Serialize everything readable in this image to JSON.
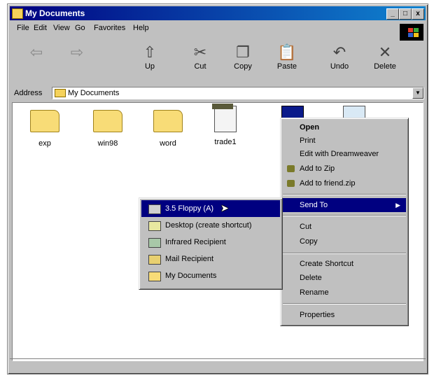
{
  "window": {
    "title": "My Documents",
    "controls": [
      "_",
      "□",
      "x"
    ]
  },
  "menubar": [
    "File",
    "Edit",
    "View",
    "Go",
    "Favorites",
    "Help"
  ],
  "toolbar": [
    {
      "label": "",
      "icon": "back-arrow-icon",
      "glyph": "⇦"
    },
    {
      "label": "",
      "icon": "forward-arrow-icon",
      "glyph": "⇨"
    },
    {
      "label": "Up",
      "icon": "up-folder-icon",
      "glyph": "⇧"
    },
    {
      "label": "Cut",
      "icon": "scissors-icon",
      "glyph": "✂"
    },
    {
      "label": "Copy",
      "icon": "copy-icon",
      "glyph": "❐"
    },
    {
      "label": "Paste",
      "icon": "paste-icon",
      "glyph": "📋"
    },
    {
      "label": "Undo",
      "icon": "undo-icon",
      "glyph": "↶"
    },
    {
      "label": "Delete",
      "icon": "delete-icon",
      "glyph": "✕"
    }
  ],
  "address": {
    "label": "Address",
    "value": "My Documents"
  },
  "files": [
    {
      "name": "exp",
      "type": "folder"
    },
    {
      "name": "win98",
      "type": "folder"
    },
    {
      "name": "word",
      "type": "folder"
    },
    {
      "name": "trade1",
      "type": "document"
    },
    {
      "name": "",
      "type": "selected"
    },
    {
      "name": "",
      "type": "network"
    }
  ],
  "context_menu": {
    "items": [
      {
        "label": "Open",
        "bold": true
      },
      {
        "label": "Print"
      },
      {
        "label": "Edit with Dreamweaver"
      },
      {
        "label": "Add to Zip",
        "icon": "winzip-icon"
      },
      {
        "label": "Add to friend.zip",
        "icon": "winzip-icon"
      },
      {
        "separator": true
      },
      {
        "label": "Send To",
        "active": true,
        "submenu": true
      },
      {
        "separator": true
      },
      {
        "label": "Cut"
      },
      {
        "label": "Copy"
      },
      {
        "separator": true
      },
      {
        "label": "Create Shortcut"
      },
      {
        "label": "Delete"
      },
      {
        "label": "Rename"
      },
      {
        "separator": true
      },
      {
        "label": "Properties"
      }
    ]
  },
  "send_to_menu": {
    "items": [
      {
        "label": "3.5 Floppy (A)",
        "icon": "floppy-icon",
        "active": true
      },
      {
        "label": "Desktop (create shortcut)",
        "icon": "desktop-shortcut-icon"
      },
      {
        "label": "Infrared Recipient",
        "icon": "infrared-icon"
      },
      {
        "label": "Mail Recipient",
        "icon": "mail-icon"
      },
      {
        "label": "My Documents",
        "icon": "my-documents-icon"
      }
    ]
  },
  "colors": {
    "title_bar": "#000080",
    "highlight": "#000080",
    "chrome": "#c0c0c0",
    "folder": "#f8dc77"
  }
}
